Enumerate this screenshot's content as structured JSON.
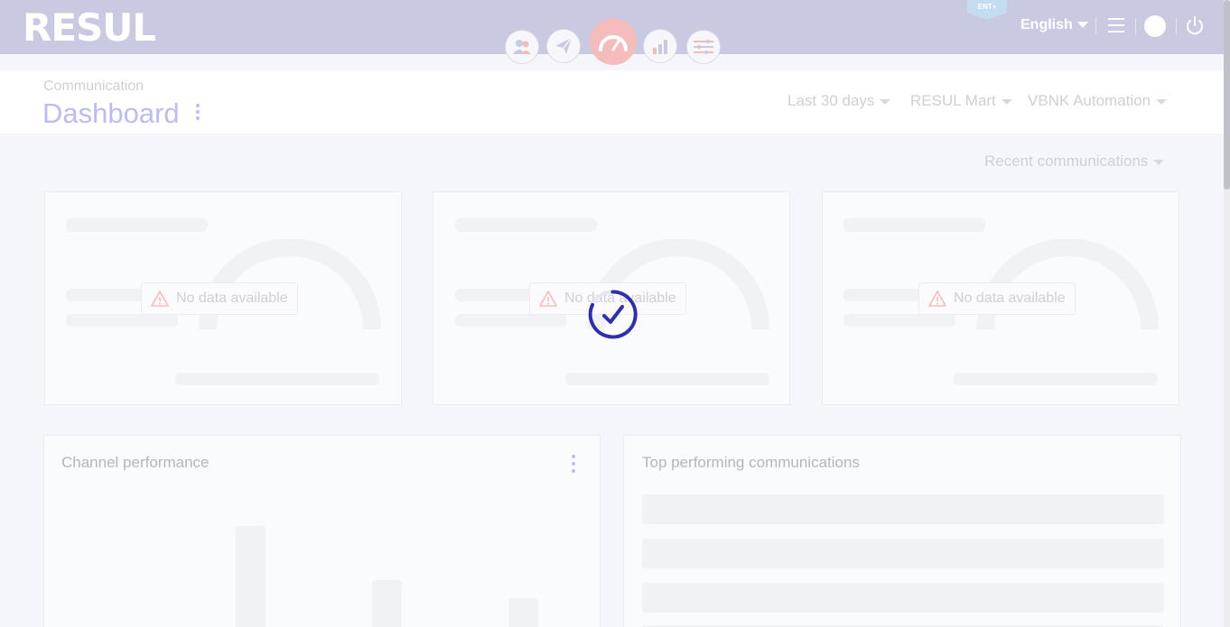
{
  "header": {
    "logo": "RESUL",
    "edition_badge": "ENT+",
    "language": "English",
    "nav_icons": [
      "audience-icon",
      "send-icon",
      "dashboard-gauge-icon",
      "analytics-icon",
      "preferences-icon"
    ],
    "active_nav": "dashboard-gauge-icon"
  },
  "page": {
    "breadcrumb": "Communication",
    "title": "Dashboard"
  },
  "filters": {
    "date_range": "Last 30 days",
    "brand": "RESUL Mart",
    "account": "VBNK Automation",
    "view": "Recent communications"
  },
  "cards": [
    {
      "no_data": "No data available"
    },
    {
      "no_data": "No data available"
    },
    {
      "no_data": "No data available"
    }
  ],
  "panels": {
    "channel_performance": "Channel performance",
    "top_communications": "Top performing communications"
  },
  "colors": {
    "header_bg": "#c9cae2",
    "accent": "#bcbcf0",
    "active_nav": "#f5bcbc",
    "spinner": "#2f2fa8"
  }
}
